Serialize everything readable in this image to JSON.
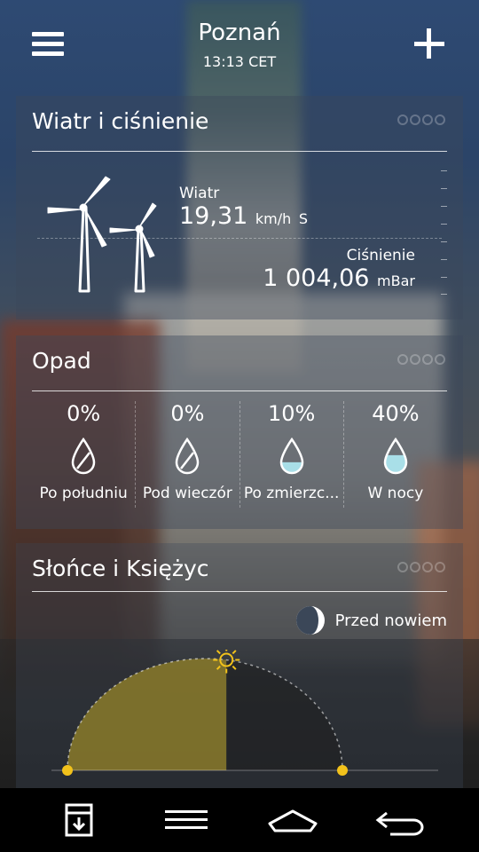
{
  "header": {
    "city": "Poznań",
    "time": "13:13 CET"
  },
  "wind": {
    "title": "Wiatr i ciśnienie",
    "wind_label": "Wiatr",
    "wind_speed": "19,31",
    "wind_unit": "km/h",
    "wind_direction": "S",
    "pressure_label": "Ciśnienie",
    "pressure_value": "1 004,06",
    "pressure_unit": "mBar"
  },
  "precip": {
    "title": "Opad",
    "periods": [
      {
        "percent": "0%",
        "label": "Po południu",
        "fill": 0
      },
      {
        "percent": "0%",
        "label": "Pod wieczór",
        "fill": 0
      },
      {
        "percent": "10%",
        "label": "Po zmierzc...",
        "fill": 0.1
      },
      {
        "percent": "40%",
        "label": "W nocy",
        "fill": 0.4
      }
    ]
  },
  "sun": {
    "title": "Słońce i Księżyc",
    "moon_phase": "Przed nowiem",
    "day_progress": 0.55
  },
  "colors": {
    "sun_fill": "#8a7a2a",
    "sun_accent": "#f2c21b",
    "water": "#a9dfe8"
  },
  "icons": {
    "menu": "hamburger-icon",
    "add": "plus-icon",
    "turbines": "wind-turbine-icon",
    "drop": "water-drop-icon",
    "moon": "moon-phase-icon",
    "sun": "sun-icon"
  }
}
